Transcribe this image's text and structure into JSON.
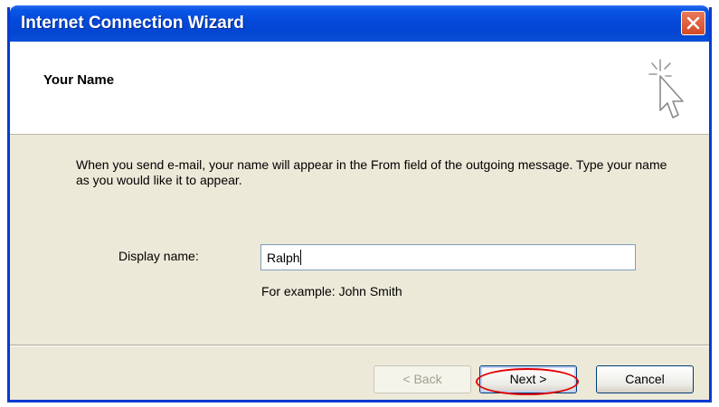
{
  "window": {
    "title": "Internet Connection Wizard",
    "close_icon": "close-icon"
  },
  "header": {
    "title": "Your Name",
    "icon": "wizard-cursor-icon"
  },
  "body": {
    "description": "When you send e-mail, your name will appear in the From field of the outgoing message. Type your name as you would like it to appear.",
    "display_name_label": "Display name:",
    "display_name_value": "Ralph",
    "example": "For example: John Smith"
  },
  "buttons": {
    "back": "< Back",
    "next": "Next >",
    "cancel": "Cancel"
  },
  "colors": {
    "titlebar": "#0449d8",
    "dialog_bg": "#ece9d8",
    "highlight": "#e00000"
  }
}
